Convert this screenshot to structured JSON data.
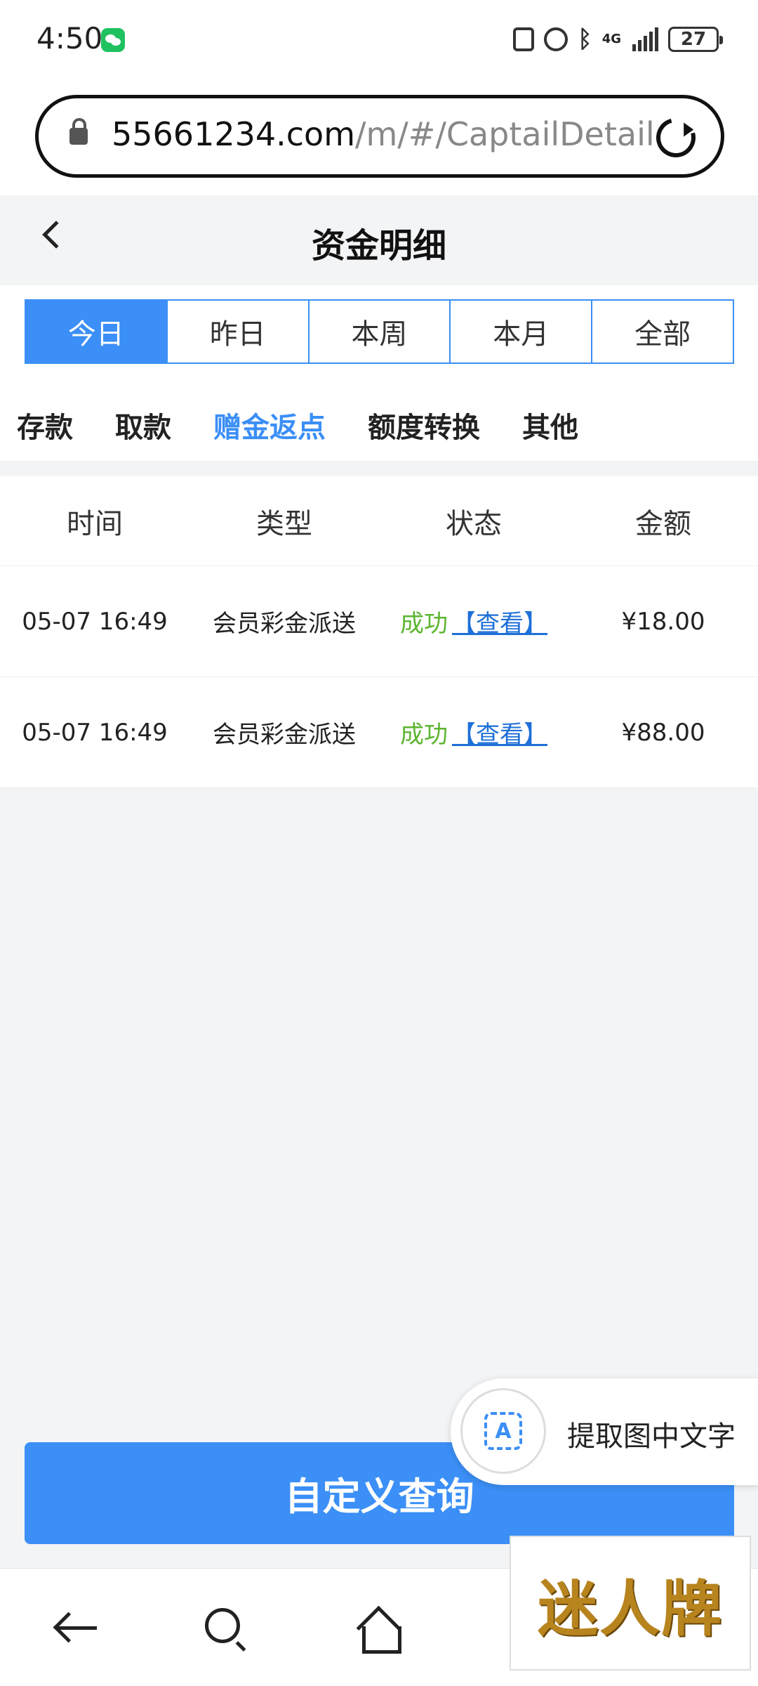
{
  "status_bar": {
    "time": "4:50",
    "network": "4G",
    "battery": "27"
  },
  "browser": {
    "url_domain": "55661234.com",
    "url_path": "/m/#/CaptailDetail"
  },
  "header": {
    "title": "资金明细"
  },
  "period_tabs": [
    {
      "label": "今日",
      "active": true
    },
    {
      "label": "昨日",
      "active": false
    },
    {
      "label": "本周",
      "active": false
    },
    {
      "label": "本月",
      "active": false
    },
    {
      "label": "全部",
      "active": false
    }
  ],
  "category_tabs": [
    {
      "label": "存款",
      "active": false
    },
    {
      "label": "取款",
      "active": false
    },
    {
      "label": "赠金返点",
      "active": true
    },
    {
      "label": "额度转换",
      "active": false
    },
    {
      "label": "其他",
      "active": false
    }
  ],
  "table": {
    "columns": [
      "时间",
      "类型",
      "状态",
      "金额"
    ],
    "rows": [
      {
        "time": "05-07 16:49",
        "type": "会员彩金派送",
        "status": "成功",
        "view": "【查看】",
        "amount": "¥18.00"
      },
      {
        "time": "05-07 16:49",
        "type": "会员彩金派送",
        "status": "成功",
        "view": "【查看】",
        "amount": "¥88.00"
      }
    ]
  },
  "query_button": "自定义查询",
  "extract_popup": {
    "icon_letter": "A",
    "label": "提取图中文字"
  },
  "watermark": {
    "text": "迷人牌"
  },
  "colors": {
    "accent": "#3b8ff6",
    "success": "#5cb531",
    "link": "#1e6fd8"
  }
}
